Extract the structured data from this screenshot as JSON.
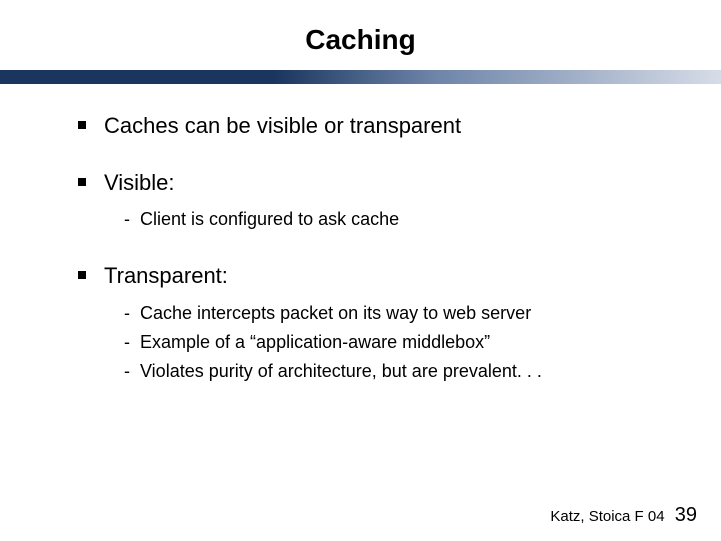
{
  "title": "Caching",
  "bullets": [
    {
      "text": "Caches can be visible or transparent",
      "subs": []
    },
    {
      "text": "Visible:",
      "subs": [
        "Client is configured to ask cache"
      ]
    },
    {
      "text": "Transparent:",
      "subs": [
        "Cache intercepts packet on its way to web server",
        "Example of a “application-aware middlebox”",
        "Violates purity of architecture, but are prevalent. . ."
      ]
    }
  ],
  "footer": {
    "author": "Katz, Stoica F 04",
    "page": "39"
  }
}
